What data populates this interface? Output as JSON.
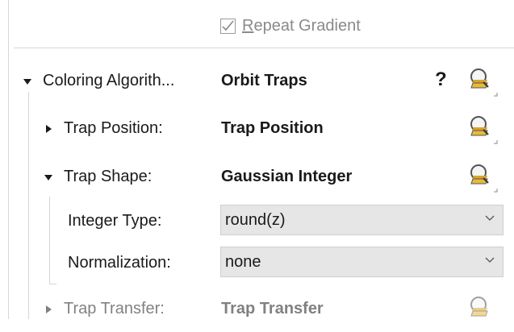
{
  "repeat_gradient": {
    "label_accel": "R",
    "label_rest": "epeat Gradient",
    "checked": true
  },
  "coloring": {
    "label": "Coloring Algorith...",
    "value": "Orbit Traps",
    "help": "?"
  },
  "rows": {
    "trap_position": {
      "label": "Trap Position:",
      "value": "Trap Position"
    },
    "trap_shape": {
      "label": "Trap Shape:",
      "value": "Gaussian Integer"
    },
    "integer_type": {
      "label": "Integer Type:",
      "selected": "round(z)"
    },
    "normalization": {
      "label": "Normalization:",
      "selected": "none"
    },
    "trap_transfer": {
      "label": "Trap Transfer:",
      "value": "Trap Transfer"
    }
  },
  "icons": {
    "browse": "magnifier-with-stack-icon",
    "expanded": "triangle-down-icon",
    "collapsed": "triangle-right-icon",
    "dropdown": "chevron-down-icon"
  }
}
